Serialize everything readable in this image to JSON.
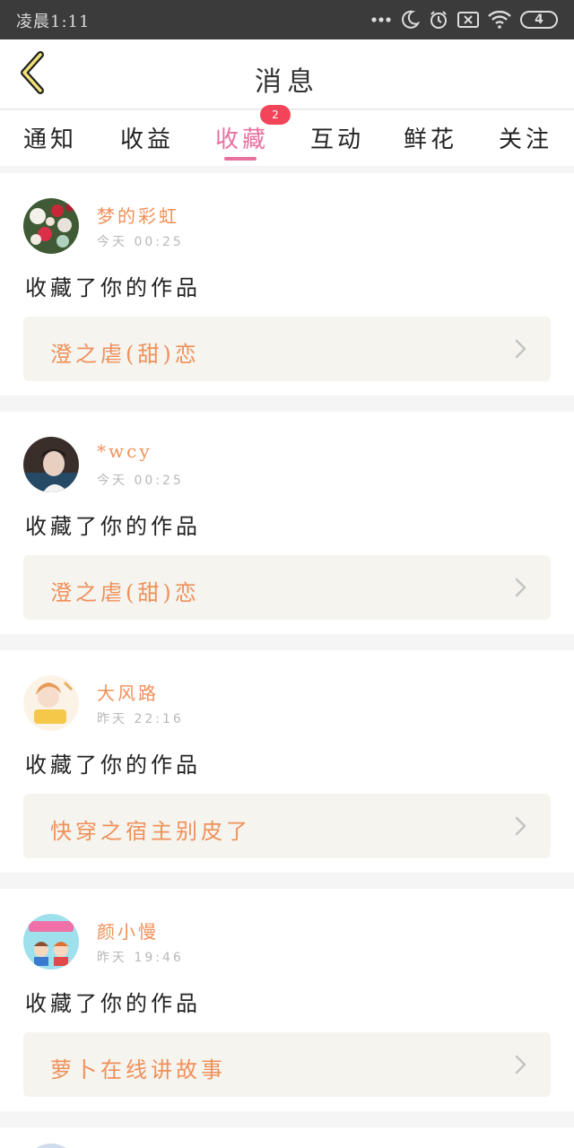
{
  "status_bar": {
    "time": "凌晨1:11",
    "battery": "4",
    "icons": [
      "more-dots-icon",
      "moon-icon",
      "alarm-icon",
      "sim-off-icon",
      "wifi-icon",
      "battery-icon"
    ]
  },
  "navbar": {
    "back_icon": "chevron-left-icon",
    "title": "消息"
  },
  "tabs": [
    {
      "label": "通知"
    },
    {
      "label": "收益"
    },
    {
      "label": "收藏",
      "badge": "2",
      "active": true
    },
    {
      "label": "互动"
    },
    {
      "label": "鲜花"
    },
    {
      "label": "关注"
    }
  ],
  "colors": {
    "accent": "#e870a0",
    "name": "#f0905a",
    "badge": "#f2455a",
    "status_bar": "#3b3b3b"
  },
  "notifications": [
    {
      "user": "梦的彩虹",
      "time": "今天 00:25",
      "action": "收藏了你的作品",
      "work": "澄之虐(甜)恋"
    },
    {
      "user": "*wcy",
      "time": "今天 00:25",
      "action": "收藏了你的作品",
      "work": "澄之虐(甜)恋"
    },
    {
      "user": "大风路",
      "time": "昨天 22:16",
      "action": "收藏了你的作品",
      "work": "快穿之宿主别皮了"
    },
    {
      "user": "颜小慢",
      "time": "昨天 19:46",
      "action": "收藏了你的作品",
      "work": "萝卜在线讲故事"
    }
  ]
}
